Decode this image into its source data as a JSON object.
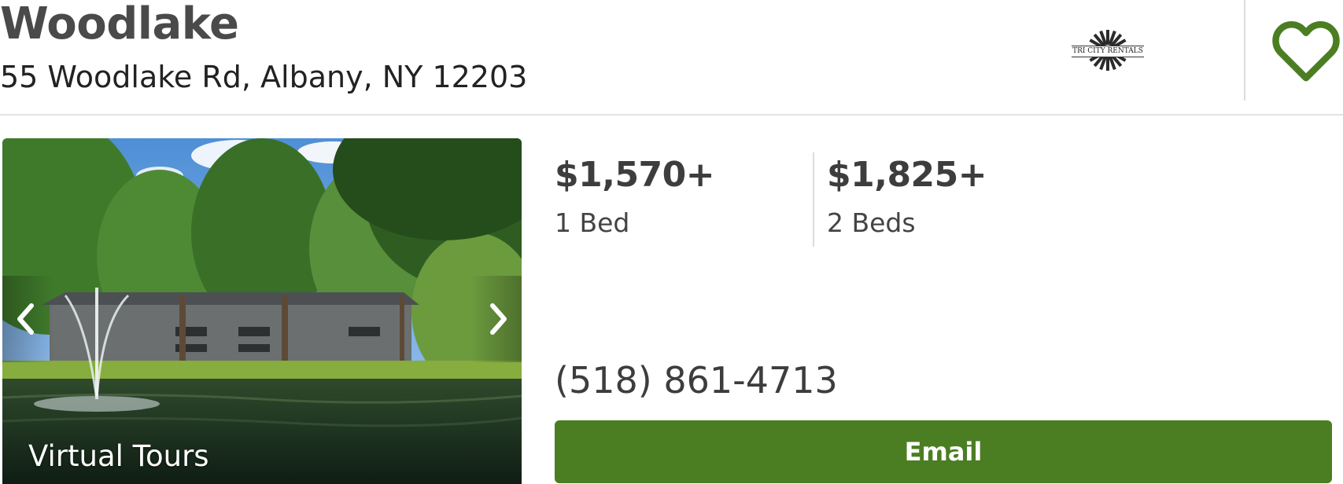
{
  "listing": {
    "name": "Woodlake",
    "address": "55 Woodlake Rd, Albany, NY 12203",
    "logo_text": "TRI CITY RENTALS",
    "favorite_icon": "heart-outline-icon"
  },
  "photo": {
    "overlay_label": "Virtual Tours",
    "prev_icon": "chevron-left-icon",
    "next_icon": "chevron-right-icon"
  },
  "pricing": [
    {
      "price": "$1,570+",
      "beds": "1 Bed"
    },
    {
      "price": "$1,825+",
      "beds": "2 Beds"
    }
  ],
  "contact": {
    "phone": "(518) 861-4713",
    "email_label": "Email"
  },
  "colors": {
    "brand_green": "#4b7d22",
    "title_gray": "#4a4a4a",
    "divider": "#dcdcdc"
  }
}
